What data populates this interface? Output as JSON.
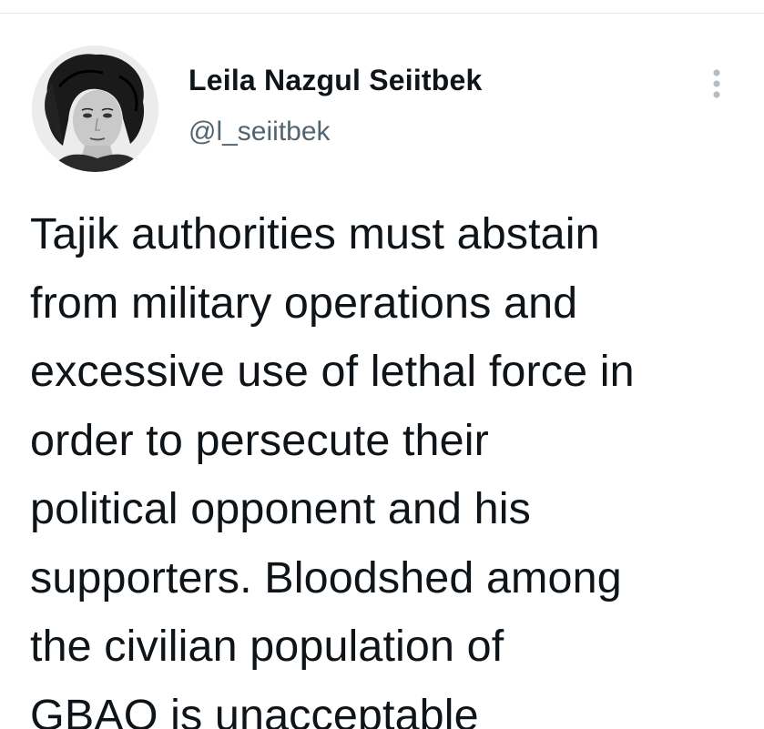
{
  "tweet": {
    "author": {
      "display_name": "Leila Nazgul Seiitbek",
      "handle": "@l_seiitbek",
      "avatar_icon": "profile-photo"
    },
    "more_icon": "vertical-ellipsis-icon",
    "text": "Tajik authorities must abstain\nfrom military operations and\nexcessive use of lethal force in\norder to persecute their\npolitical opponent and his\nsupporters. Bloodshed among\nthe civilian population of\nGBAO is unacceptable"
  },
  "colors": {
    "text_primary": "#0f1419",
    "text_secondary": "#536471",
    "background": "#ffffff"
  }
}
